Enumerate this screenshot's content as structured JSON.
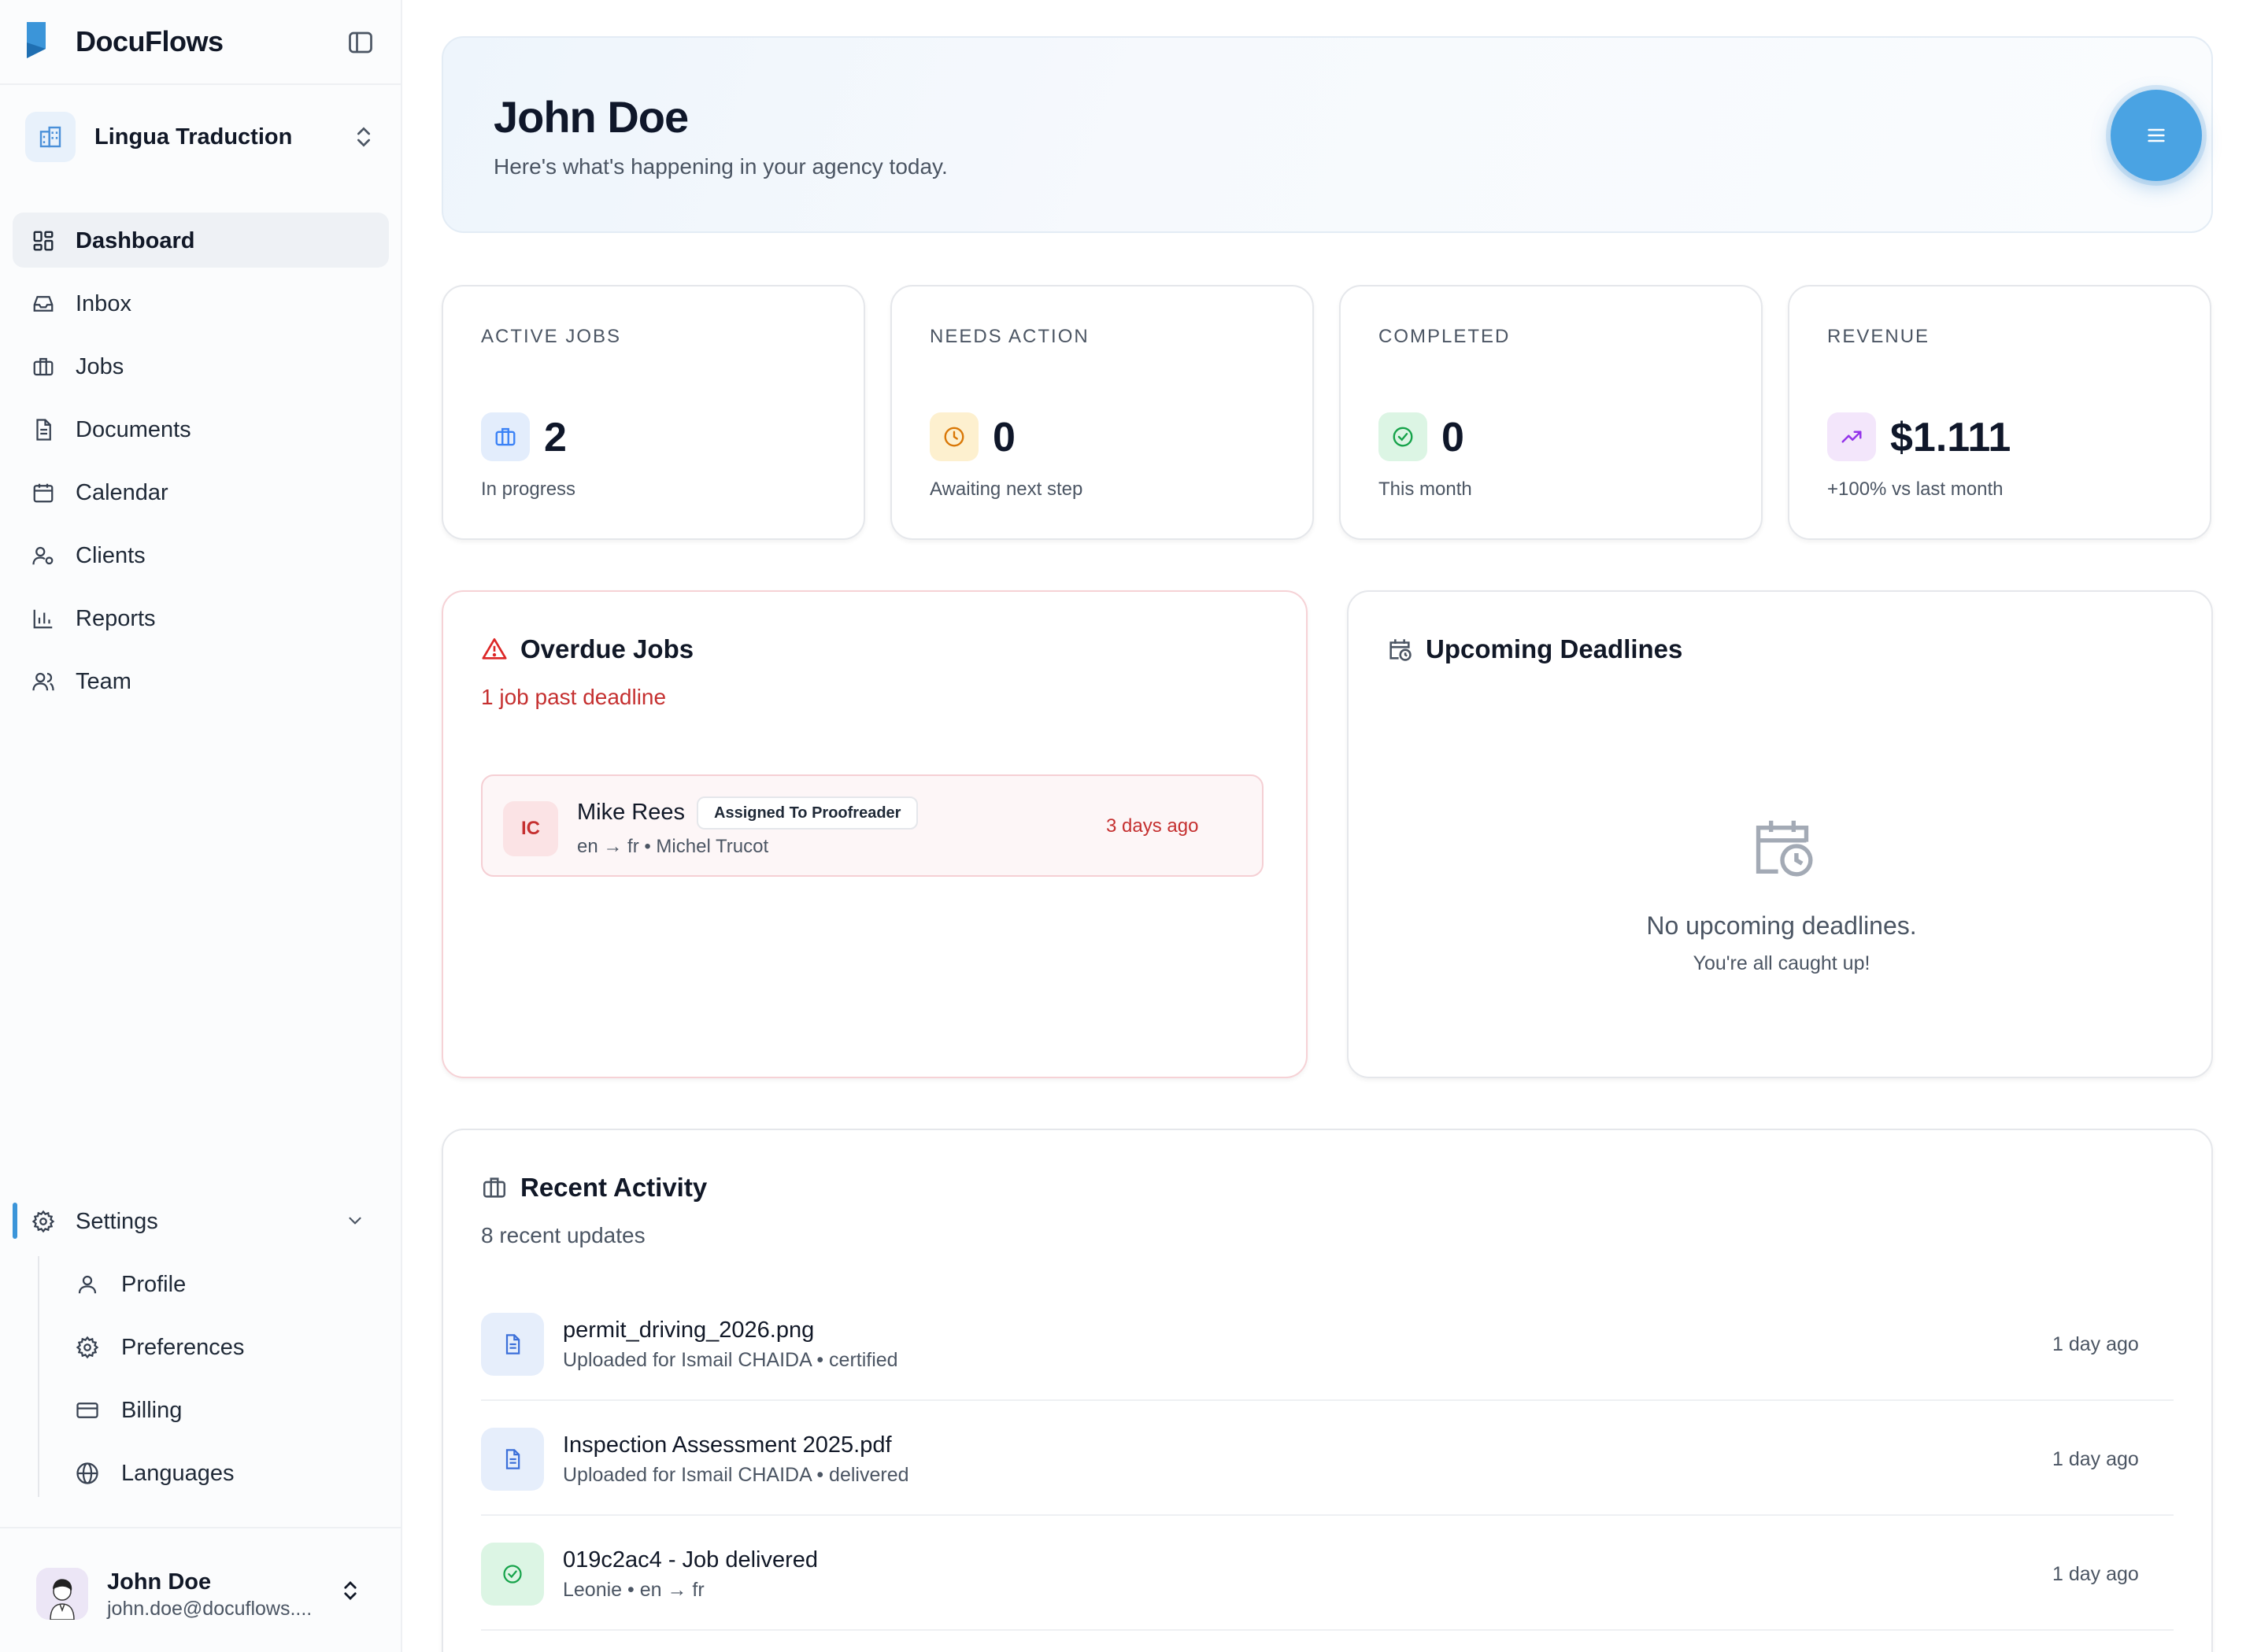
{
  "brand": {
    "name": "DocuFlows"
  },
  "org": {
    "name": "Lingua Traduction"
  },
  "nav": {
    "items": [
      {
        "label": "Dashboard",
        "icon": "dashboard-icon",
        "active": true
      },
      {
        "label": "Inbox",
        "icon": "inbox-icon"
      },
      {
        "label": "Jobs",
        "icon": "briefcase-icon"
      },
      {
        "label": "Documents",
        "icon": "document-icon"
      },
      {
        "label": "Calendar",
        "icon": "calendar-icon"
      },
      {
        "label": "Clients",
        "icon": "clients-icon"
      },
      {
        "label": "Reports",
        "icon": "bar-chart-icon"
      },
      {
        "label": "Team",
        "icon": "team-icon"
      }
    ],
    "settings": {
      "label": "Settings",
      "children": [
        {
          "label": "Profile",
          "icon": "user-icon"
        },
        {
          "label": "Preferences",
          "icon": "gear-icon"
        },
        {
          "label": "Billing",
          "icon": "credit-card-icon"
        },
        {
          "label": "Languages",
          "icon": "globe-icon"
        }
      ]
    }
  },
  "user": {
    "name": "John Doe",
    "email": "john.doe@docuflows...."
  },
  "hero": {
    "title": "John Doe",
    "subtitle": "Here's what's happening in your agency today."
  },
  "stats": [
    {
      "label": "ACTIVE JOBS",
      "value": "2",
      "sub": "In progress",
      "icon": "briefcase-icon",
      "color": "#3b82f6"
    },
    {
      "label": "NEEDS ACTION",
      "value": "0",
      "sub": "Awaiting next step",
      "icon": "clock-icon",
      "color": "#d97706"
    },
    {
      "label": "COMPLETED",
      "value": "0",
      "sub": "This month",
      "icon": "check-circle-icon",
      "color": "#16a34a"
    },
    {
      "label": "REVENUE",
      "value": "$1.111",
      "sub": "+100% vs last month",
      "icon": "trending-up-icon",
      "color": "#9333ea"
    }
  ],
  "overdue": {
    "title": "Overdue Jobs",
    "subtitle": "1 job past deadline",
    "jobs": [
      {
        "initials": "IC",
        "name": "Mike Rees",
        "status": "Assigned To Proofreader",
        "meta": "en → fr  •  Michel Trucot",
        "when": "3 days ago"
      }
    ]
  },
  "deadlines": {
    "title": "Upcoming Deadlines",
    "empty_title": "No upcoming deadlines.",
    "empty_sub": "You're all caught up!"
  },
  "activity": {
    "title": "Recent Activity",
    "subtitle": "8 recent updates",
    "items": [
      {
        "title": "permit_driving_2026.png",
        "sub": "Uploaded for Ismail CHAIDA • certified",
        "time": "1 day ago",
        "icon": "document-icon"
      },
      {
        "title": "Inspection Assessment 2025.pdf",
        "sub": "Uploaded for Ismail CHAIDA • delivered",
        "time": "1 day ago",
        "icon": "document-icon"
      },
      {
        "title": "019c2ac4 - Job delivered",
        "sub": "Leonie • en → fr",
        "time": "1 day ago",
        "icon": "check-circle-icon"
      }
    ]
  },
  "colors": {
    "accent": "#4aa3e3",
    "danger": "#c53030"
  }
}
